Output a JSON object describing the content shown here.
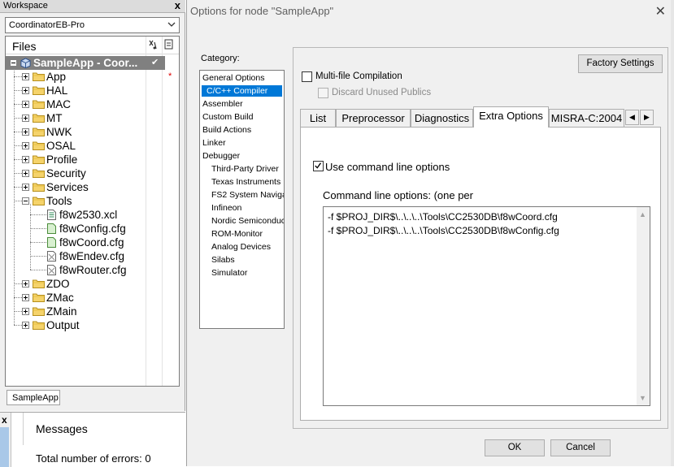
{
  "workspace": {
    "title": "Workspace",
    "close_glyph": "x",
    "configuration": "CoordinatorEB-Pro",
    "files_header": "Files",
    "root": {
      "label": "SampleApp - Coor...",
      "check": "✔"
    },
    "tree": [
      {
        "label": "App",
        "type": "folder",
        "star": "*"
      },
      {
        "label": "HAL",
        "type": "folder"
      },
      {
        "label": "MAC",
        "type": "folder"
      },
      {
        "label": "MT",
        "type": "folder"
      },
      {
        "label": "NWK",
        "type": "folder"
      },
      {
        "label": "OSAL",
        "type": "folder"
      },
      {
        "label": "Profile",
        "type": "folder"
      },
      {
        "label": "Security",
        "type": "folder"
      },
      {
        "label": "Services",
        "type": "folder"
      },
      {
        "label": "Tools",
        "type": "folder",
        "expanded": true
      },
      {
        "label": "f8w2530.xcl",
        "type": "file",
        "icon": "xcl-file-icon"
      },
      {
        "label": "f8wConfig.cfg",
        "type": "file",
        "icon": "cfg-file-icon"
      },
      {
        "label": "f8wCoord.cfg",
        "type": "file",
        "icon": "cfg-file-icon"
      },
      {
        "label": "f8wEndev.cfg",
        "type": "file",
        "icon": "excluded-file-icon"
      },
      {
        "label": "f8wRouter.cfg",
        "type": "file",
        "icon": "excluded-file-icon"
      },
      {
        "label": "ZDO",
        "type": "folder"
      },
      {
        "label": "ZMac",
        "type": "folder"
      },
      {
        "label": "ZMain",
        "type": "folder"
      },
      {
        "label": "Output",
        "type": "folder"
      }
    ],
    "tab": "SampleApp"
  },
  "messages": {
    "close_glyph": "x",
    "header": "Messages",
    "total": "Total number of errors: 0"
  },
  "dialog": {
    "title": "Options for node \"SampleApp\"",
    "close_glyph": "✕",
    "category_label": "Category:",
    "categories": [
      {
        "label": "General Options",
        "indent": false
      },
      {
        "label": "C/C++ Compiler",
        "indent": false,
        "selected": true
      },
      {
        "label": "Assembler",
        "indent": false
      },
      {
        "label": "Custom Build",
        "indent": false
      },
      {
        "label": "Build Actions",
        "indent": false
      },
      {
        "label": "Linker",
        "indent": false
      },
      {
        "label": "Debugger",
        "indent": false
      },
      {
        "label": "Third-Party Driver",
        "indent": true
      },
      {
        "label": "Texas Instruments",
        "indent": true
      },
      {
        "label": "FS2 System Naviga",
        "indent": true
      },
      {
        "label": "Infineon",
        "indent": true
      },
      {
        "label": "Nordic Semiconduc",
        "indent": true
      },
      {
        "label": "ROM-Monitor",
        "indent": true
      },
      {
        "label": "Analog Devices",
        "indent": true
      },
      {
        "label": "Silabs",
        "indent": true
      },
      {
        "label": "Simulator",
        "indent": true
      }
    ],
    "factory_settings": "Factory Settings",
    "multi_file": {
      "label": "Multi-file Compilation",
      "checked": false
    },
    "discard_unused": {
      "label": "Discard Unused Publics",
      "checked": false,
      "disabled": true
    },
    "tabs": [
      "List",
      "Preprocessor",
      "Diagnostics",
      "Extra Options",
      "MISRA-C:2004"
    ],
    "active_tab": "Extra Options",
    "tab_prev": "◀",
    "tab_next": "▶",
    "use_cmdline": {
      "label": "Use command line options",
      "checked": true
    },
    "cmdline_label": "Command line options:  (one per",
    "cmdline_lines": [
      "-f $PROJ_DIR$\\..\\..\\..\\Tools\\CC2530DB\\f8wCoord.cfg",
      "-f $PROJ_DIR$\\..\\..\\..\\Tools\\CC2530DB\\f8wConfig.cfg"
    ],
    "ok": "OK",
    "cancel": "Cancel"
  }
}
